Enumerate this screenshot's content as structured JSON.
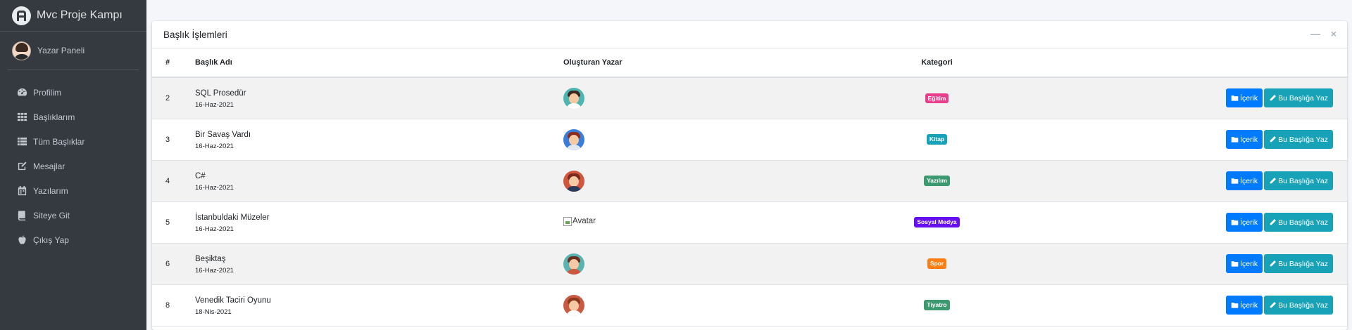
{
  "app": {
    "brand": "Mvc Proje Kampı"
  },
  "user": {
    "name": "Yazar Paneli"
  },
  "sidebar": {
    "items": [
      {
        "label": "Profilim",
        "icon": "dashboard-icon"
      },
      {
        "label": "Başlıklarım",
        "icon": "grid-icon"
      },
      {
        "label": "Tüm Başlıklar",
        "icon": "list-icon"
      },
      {
        "label": "Mesajlar",
        "icon": "edit-icon"
      },
      {
        "label": "Yazılarım",
        "icon": "calendar-icon"
      },
      {
        "label": "Siteye Git",
        "icon": "book-icon"
      },
      {
        "label": "Çıkış Yap",
        "icon": "apple-icon"
      }
    ]
  },
  "card": {
    "title": "Başlık İşlemleri"
  },
  "table": {
    "headers": {
      "num": "#",
      "title": "Başlık Adı",
      "author": "Oluşturan Yazar",
      "category": "Kategori"
    },
    "rows": [
      {
        "id": "2",
        "title": "SQL Prosedür",
        "date": "16-Haz-2021",
        "category": "Eğitim",
        "color": "#e83e8c",
        "avatar": "av-teal"
      },
      {
        "id": "3",
        "title": "Bir Savaş Vardı",
        "date": "16-Haz-2021",
        "category": "Kitap",
        "color": "#17a2b8",
        "avatar": "av-blue"
      },
      {
        "id": "4",
        "title": "C#",
        "date": "16-Haz-2021",
        "category": "Yazılım",
        "color": "#3d9970",
        "avatar": "av-red"
      },
      {
        "id": "5",
        "title": "İstanbuldaki Müzeler",
        "date": "16-Haz-2021",
        "category": "Sosyal Medya",
        "color": "#6610f2",
        "avatar_alt": "Avatar"
      },
      {
        "id": "6",
        "title": "Beşiktaş",
        "date": "16-Haz-2021",
        "category": "Spor",
        "color": "#fd7e14",
        "avatar": "av-teal2"
      },
      {
        "id": "8",
        "title": "Venedik Taciri Oyunu",
        "date": "18-Nis-2021",
        "category": "Tiyatro",
        "color": "#3d9970",
        "avatar": "av-red2"
      }
    ],
    "actions": {
      "content": "İçerik",
      "write": "Bu Başlığa Yaz"
    }
  }
}
